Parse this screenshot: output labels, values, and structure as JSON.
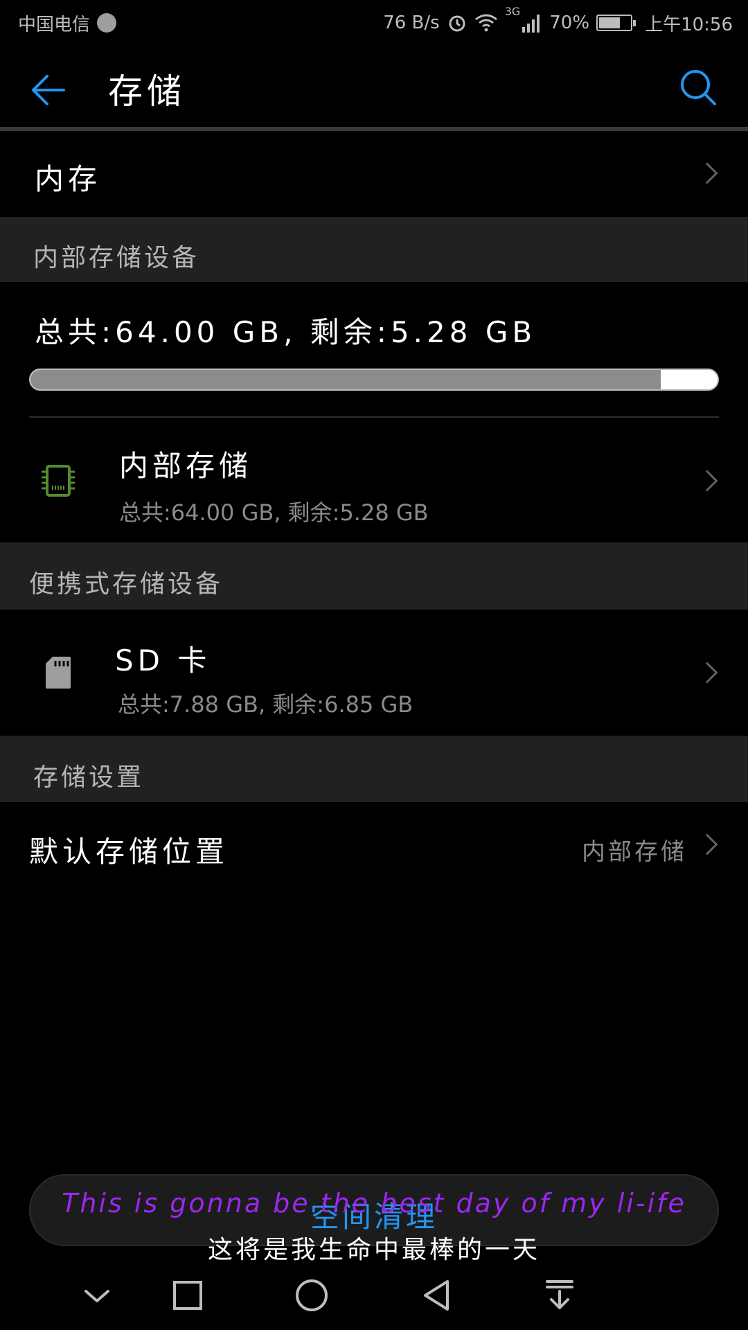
{
  "status_bar": {
    "carrier": "中国电信",
    "net_speed": "76 B/s",
    "network": "3G",
    "battery": "70%",
    "battery_level": 0.7,
    "time": "上午10:56"
  },
  "header": {
    "title": "存储"
  },
  "memory_row": {
    "label": "内存"
  },
  "internal_section": {
    "header": "内部存储设备",
    "summary": "总共:64.00 GB, 剩余:5.28 GB",
    "used_fraction": 0.9175,
    "item": {
      "title": "内部存储",
      "detail": "总共:64.00 GB, 剩余:5.28 GB",
      "icon": "chip-icon",
      "icon_color": "#558b2f"
    }
  },
  "portable_section": {
    "header": "便携式存储设备",
    "item": {
      "title": "SD 卡",
      "detail": "总共:7.88 GB, 剩余:6.85 GB",
      "icon": "sd-card-icon"
    }
  },
  "settings_section": {
    "header": "存储设置",
    "default_location": {
      "label": "默认存储位置",
      "value": "内部存储"
    }
  },
  "cleanup_button": {
    "label": "空间清理"
  },
  "overlay_subtitles": {
    "english": "This is gonna be the best day of my li-ife",
    "chinese": "这将是我生命中最棒的一天"
  },
  "colors": {
    "accent": "#2196f3",
    "background": "#000000",
    "section_bg": "#212121",
    "subtitle_purple": "#9c27f0"
  }
}
